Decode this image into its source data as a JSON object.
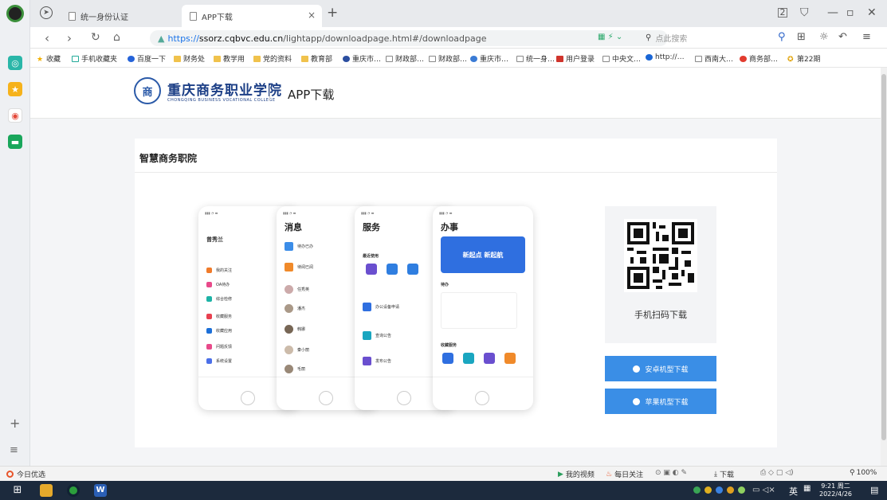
{
  "browser": {
    "tabs": [
      {
        "label": "统一身份认证"
      },
      {
        "label": "APP下载"
      }
    ],
    "url": {
      "scheme": "https://",
      "host": "ssorz.cqbvc.edu.cn",
      "path": "/lightapp/downloadpage.html#/downloadpage"
    },
    "search_placeholder": "点此搜索",
    "bookmarks": [
      "收藏",
      "手机收藏夹",
      "百度一下",
      "财务处",
      "教学用",
      "党的资料",
      "教育部",
      "重庆市…",
      "财政部…",
      "财政部…",
      "重庆市…",
      "统一身…",
      "用户登录",
      "中央文…",
      "http://…",
      "西南大…",
      "商务部…",
      "第22期"
    ]
  },
  "site": {
    "school_name": "重庆商务职业学院",
    "school_name_en": "CHONGQING BUSINESS VOCATIONAL COLLEGE",
    "logo_char": "商",
    "app_title": "APP下载"
  },
  "card": {
    "title": "智慧商务职院",
    "qr_label": "手机扫码下载",
    "android_button": "安卓机型下载",
    "ios_button": "苹果机型下载"
  },
  "phones": [
    {
      "title": "",
      "user": "曾秀兰",
      "rows": [
        "我的关注",
        "OA待办",
        "综合检修",
        "收藏服务",
        "收藏应用",
        "问题反馈",
        "系统设置"
      ]
    },
    {
      "title": "消息",
      "rows": [
        "待办已办",
        "待阅已阅",
        "任秀英",
        "潘杰",
        "韩娜",
        "秦小丽",
        "毛丽"
      ]
    },
    {
      "title": "服务",
      "rows": [
        "最近使用",
        "办公设备申请",
        "查询公告",
        "发布公告"
      ]
    },
    {
      "title": "办事",
      "banner": "新起点 新起航",
      "rows": [
        "待办",
        "收藏服务"
      ]
    }
  ],
  "statusbar": {
    "left": "今日优选",
    "items": [
      "我的视频",
      "每日关注",
      "下载"
    ],
    "zoom": "100%"
  },
  "taskbar": {
    "time": "9:21 周二",
    "date": "2022/4/26",
    "ime": "英"
  }
}
